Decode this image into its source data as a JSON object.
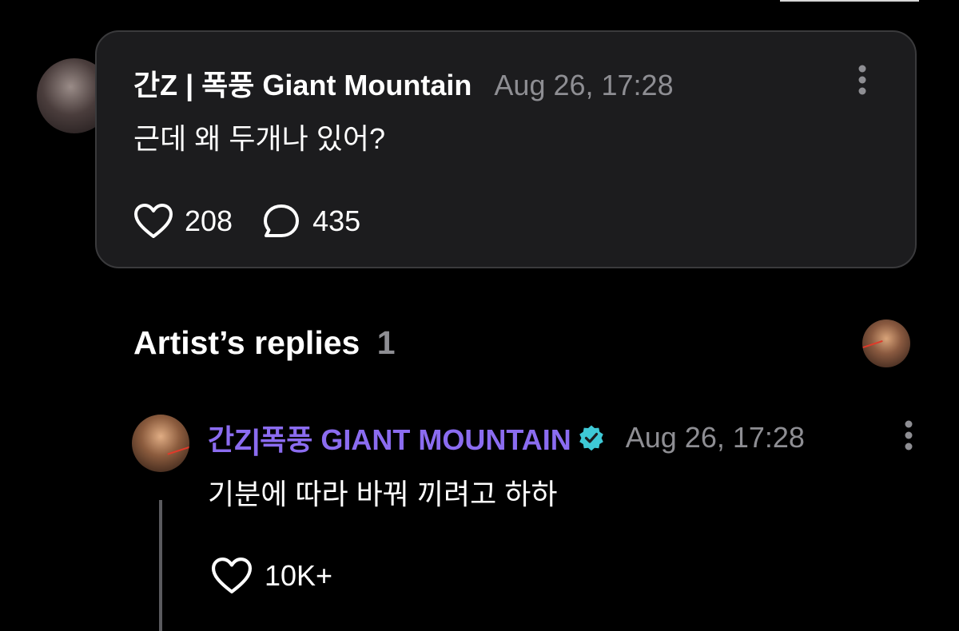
{
  "post": {
    "author": "간Z | 폭풍 Giant Mountain",
    "time": "Aug 26, 17:28",
    "text": "근데 왜 두개나 있어?",
    "like_count": "208",
    "comment_count": "435"
  },
  "replies": {
    "title": "Artist’s replies",
    "count": "1"
  },
  "reply": {
    "author": "간Z|폭풍 GIANT MOUNTAIN",
    "time": "Aug 26, 17:28",
    "text": "기분에 따라 바꿔 끼려고 하하",
    "like_count": "10K+"
  },
  "colors": {
    "background": "#000000",
    "card": "#1c1c1e",
    "card_border": "#3a3a3c",
    "artist_name": "#8b6cf0",
    "verified_badge": "#3ec9d6",
    "muted_text": "#8e8e93"
  },
  "icons": {
    "post_more": "vertical-dots-icon",
    "like": "heart-outline-icon",
    "comment": "speech-bubble-icon",
    "verified": "verified-badge-icon",
    "reply_more": "vertical-dots-icon"
  }
}
